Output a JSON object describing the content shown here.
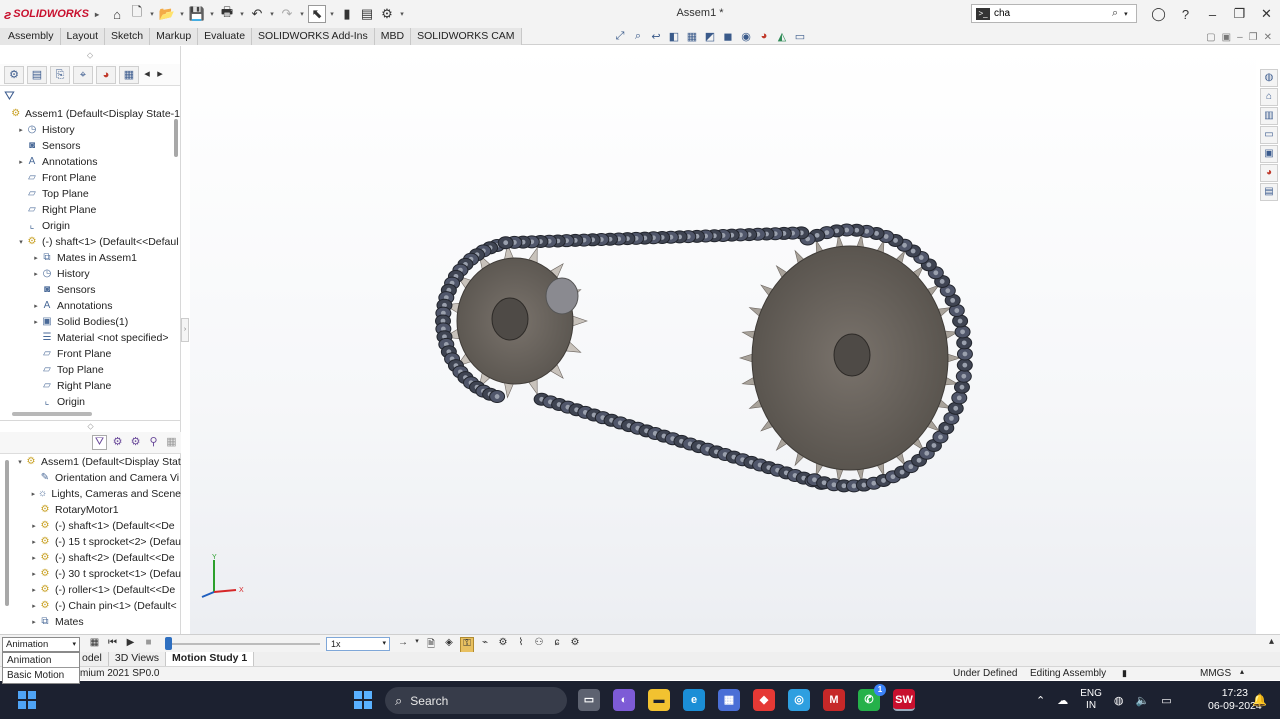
{
  "app": {
    "brand": "SOLIDWORKS",
    "document_title": "Assem1 *",
    "search_value": "cha"
  },
  "command_tabs": [
    "Assembly",
    "Layout",
    "Sketch",
    "Markup",
    "Evaluate",
    "SOLIDWORKS Add-Ins",
    "MBD",
    "SOLIDWORKS CAM"
  ],
  "feature_tree": [
    {
      "label": "Assem1  (Default<Display State-1",
      "icon": "assembly-icon",
      "expander": "",
      "indent": 0
    },
    {
      "label": "History",
      "icon": "history-icon",
      "expander": "▸",
      "indent": 1
    },
    {
      "label": "Sensors",
      "icon": "sensors-icon",
      "expander": "",
      "indent": 1
    },
    {
      "label": "Annotations",
      "icon": "annotations-icon",
      "expander": "▸",
      "indent": 1
    },
    {
      "label": "Front Plane",
      "icon": "plane-icon",
      "expander": "",
      "indent": 1
    },
    {
      "label": "Top Plane",
      "icon": "plane-icon",
      "expander": "",
      "indent": 1
    },
    {
      "label": "Right Plane",
      "icon": "plane-icon",
      "expander": "",
      "indent": 1
    },
    {
      "label": "Origin",
      "icon": "origin-icon",
      "expander": "",
      "indent": 1
    },
    {
      "label": "(-) shaft<1> (Default<<Defaul",
      "icon": "part-icon",
      "expander": "▾",
      "indent": 1
    },
    {
      "label": "Mates in Assem1",
      "icon": "mates-icon",
      "expander": "▸",
      "indent": 2
    },
    {
      "label": "History",
      "icon": "history-icon",
      "expander": "▸",
      "indent": 2
    },
    {
      "label": "Sensors",
      "icon": "sensors-icon",
      "expander": "",
      "indent": 2
    },
    {
      "label": "Annotations",
      "icon": "annotations-icon",
      "expander": "▸",
      "indent": 2
    },
    {
      "label": "Solid Bodies(1)",
      "icon": "solid-bodies-icon",
      "expander": "▸",
      "indent": 2
    },
    {
      "label": "Material <not specified>",
      "icon": "material-icon",
      "expander": "",
      "indent": 2
    },
    {
      "label": "Front Plane",
      "icon": "plane-icon",
      "expander": "",
      "indent": 2
    },
    {
      "label": "Top Plane",
      "icon": "plane-icon",
      "expander": "",
      "indent": 2
    },
    {
      "label": "Right Plane",
      "icon": "plane-icon",
      "expander": "",
      "indent": 2
    },
    {
      "label": "Origin",
      "icon": "origin-icon",
      "expander": "",
      "indent": 2
    }
  ],
  "motion_tree": [
    {
      "label": "Assem1  (Default<Display Stat",
      "icon": "assembly-icon",
      "expander": "▾",
      "indent": 0
    },
    {
      "label": "Orientation and Camera Vi",
      "icon": "camera-icon",
      "expander": "",
      "indent": 1
    },
    {
      "label": "Lights, Cameras and Scene",
      "icon": "lights-icon",
      "expander": "▸",
      "indent": 1
    },
    {
      "label": "RotaryMotor1",
      "icon": "motor-icon",
      "expander": "",
      "indent": 1
    },
    {
      "label": "(-) shaft<1> (Default<<De",
      "icon": "part-icon",
      "expander": "▸",
      "indent": 1
    },
    {
      "label": "(-) 15 t sprocket<2> (Defau",
      "icon": "part-icon",
      "expander": "▸",
      "indent": 1
    },
    {
      "label": "(-) shaft<2> (Default<<De",
      "icon": "part-icon",
      "expander": "▸",
      "indent": 1
    },
    {
      "label": "(-) 30 t sprocket<1> (Defau",
      "icon": "part-icon",
      "expander": "▸",
      "indent": 1
    },
    {
      "label": "(-) roller<1> (Default<<De",
      "icon": "part-icon",
      "expander": "▸",
      "indent": 1
    },
    {
      "label": "(-) Chain pin<1> (Default<",
      "icon": "part-icon",
      "expander": "▸",
      "indent": 1
    },
    {
      "label": "Mates",
      "icon": "mates-icon",
      "expander": "▸",
      "indent": 1
    }
  ],
  "triad": {
    "x": "X",
    "y": "Y"
  },
  "motion": {
    "study_type": "Animation",
    "options": [
      "Animation",
      "Basic Motion"
    ],
    "speed": "1x"
  },
  "bottom_tabs": [
    "odel",
    "3D Views",
    "Motion Study 1"
  ],
  "status": {
    "product": "mium 2021 SP0.0",
    "definition": "Under Defined",
    "mode": "Editing Assembly",
    "units": "MMGS"
  },
  "taskbar": {
    "search_label": "Search",
    "lang_top": "ENG",
    "lang_bottom": "IN",
    "time": "17:23",
    "date": "06-09-2024",
    "whatsapp_badge": "1",
    "sw_label": "SW"
  }
}
